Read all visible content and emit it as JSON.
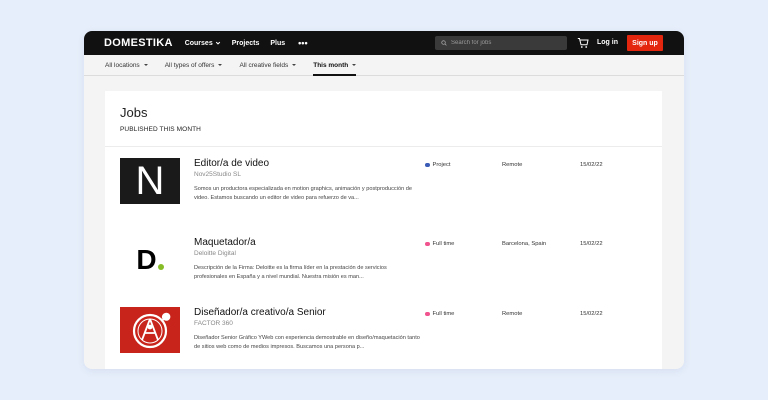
{
  "brand": {
    "logo": "DOMESTIKA",
    "accent": "#e4260f"
  },
  "nav": {
    "items": [
      {
        "label": "Courses",
        "dropdown": true
      },
      {
        "label": "Projects"
      },
      {
        "label": "Plus"
      }
    ],
    "more": "•••",
    "search_placeholder": "Search for jobs",
    "login": "Log in",
    "signup": "Sign up"
  },
  "filters": [
    {
      "label": "All locations"
    },
    {
      "label": "All types of offers"
    },
    {
      "label": "All creative fields"
    },
    {
      "label": "This month",
      "active": true
    }
  ],
  "page": {
    "title": "Jobs",
    "subtitle": "PUBLISHED THIS MONTH"
  },
  "jobs": [
    {
      "title": "Editor/a de video",
      "company": "Nov25Studio SL",
      "description": "Somos un productora especializada en motion graphics, animación y postproducción de video. Estamos buscando un editor de video para refuerzo de va...",
      "type": "Project",
      "type_color": "#3a5cb7",
      "location": "Remote",
      "date": "15/02/22",
      "logo_text": "N"
    },
    {
      "title": "Maquetador/a",
      "company": "Deloitte Digital",
      "description": "Descripción de la Firma: Deloitte es la firma líder en la prestación de servicios profesionales en España y a nivel mundial. Nuestra misión es man...",
      "type": "Full time",
      "type_color": "#f0538e",
      "location": "Barcelona, Spain",
      "date": "15/02/22",
      "logo_text": "D."
    },
    {
      "title": "Diseñador/a creativo/a Senior",
      "company": "FACTOR 360",
      "description": "Diseñador Senior Gráfico YWeb con experiencia demostrable en diseño/maquetación tanto de sitios web como de medios impresos. Buscamos una persona p...",
      "type": "Full time",
      "type_color": "#f0538e",
      "location": "Remote",
      "date": "15/02/22",
      "logo_text": ""
    }
  ]
}
